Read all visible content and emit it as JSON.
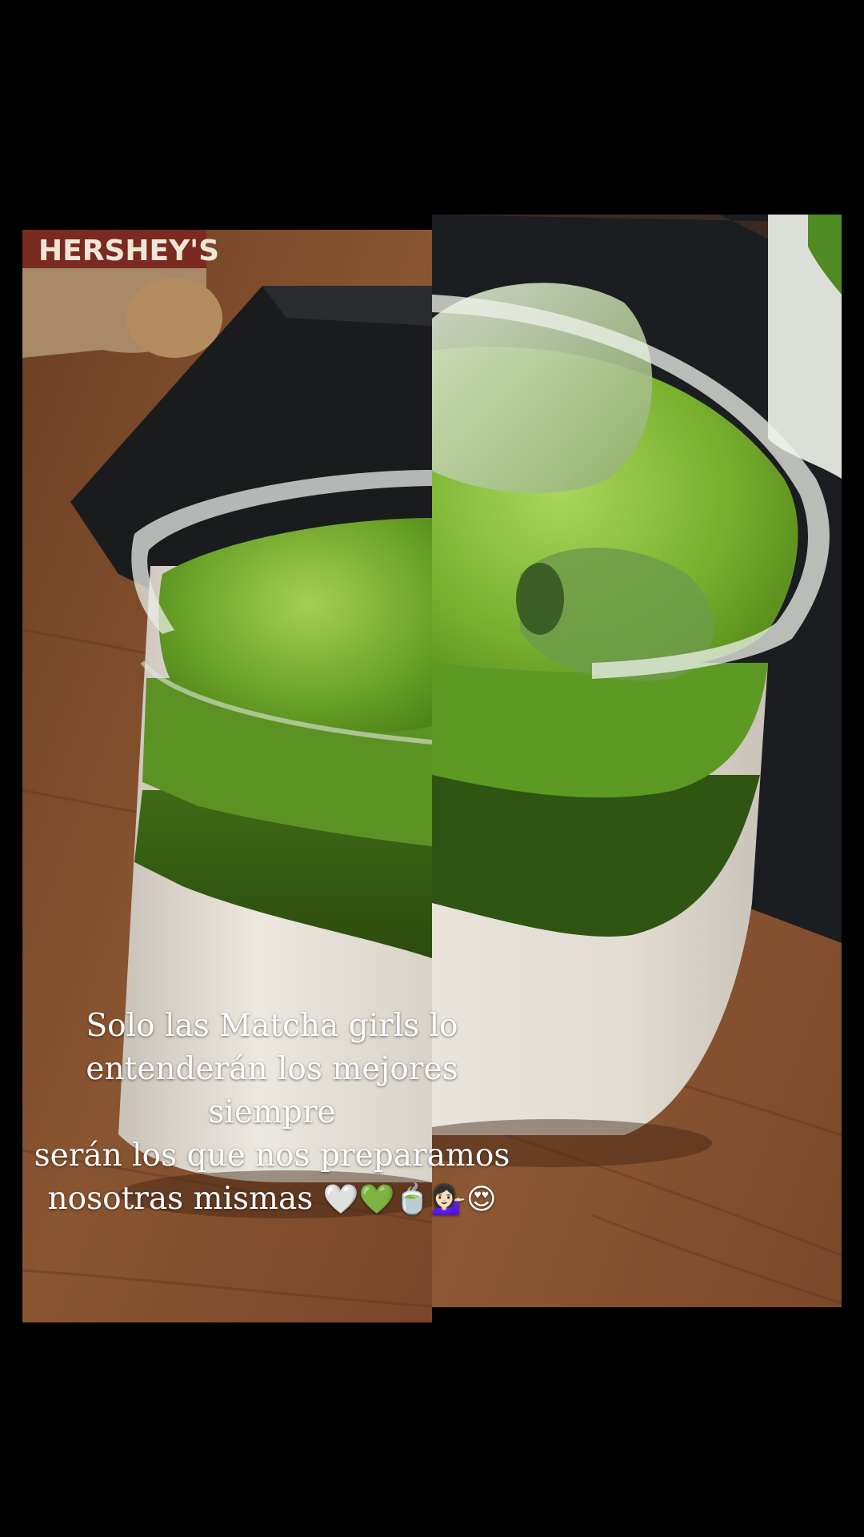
{
  "story": {
    "caption_lines": [
      "Solo las Matcha girls lo",
      "entenderán los mejores siempre",
      "serán los que nos preparamos",
      "nosotras mismas"
    ],
    "caption_emojis": "🤍💚🍵💁🏻‍♀️😍",
    "package_text": "HERSHEY'S"
  },
  "colors": {
    "background": "#000000",
    "matcha": "#5f9a28",
    "table": "#7a4a2c"
  }
}
